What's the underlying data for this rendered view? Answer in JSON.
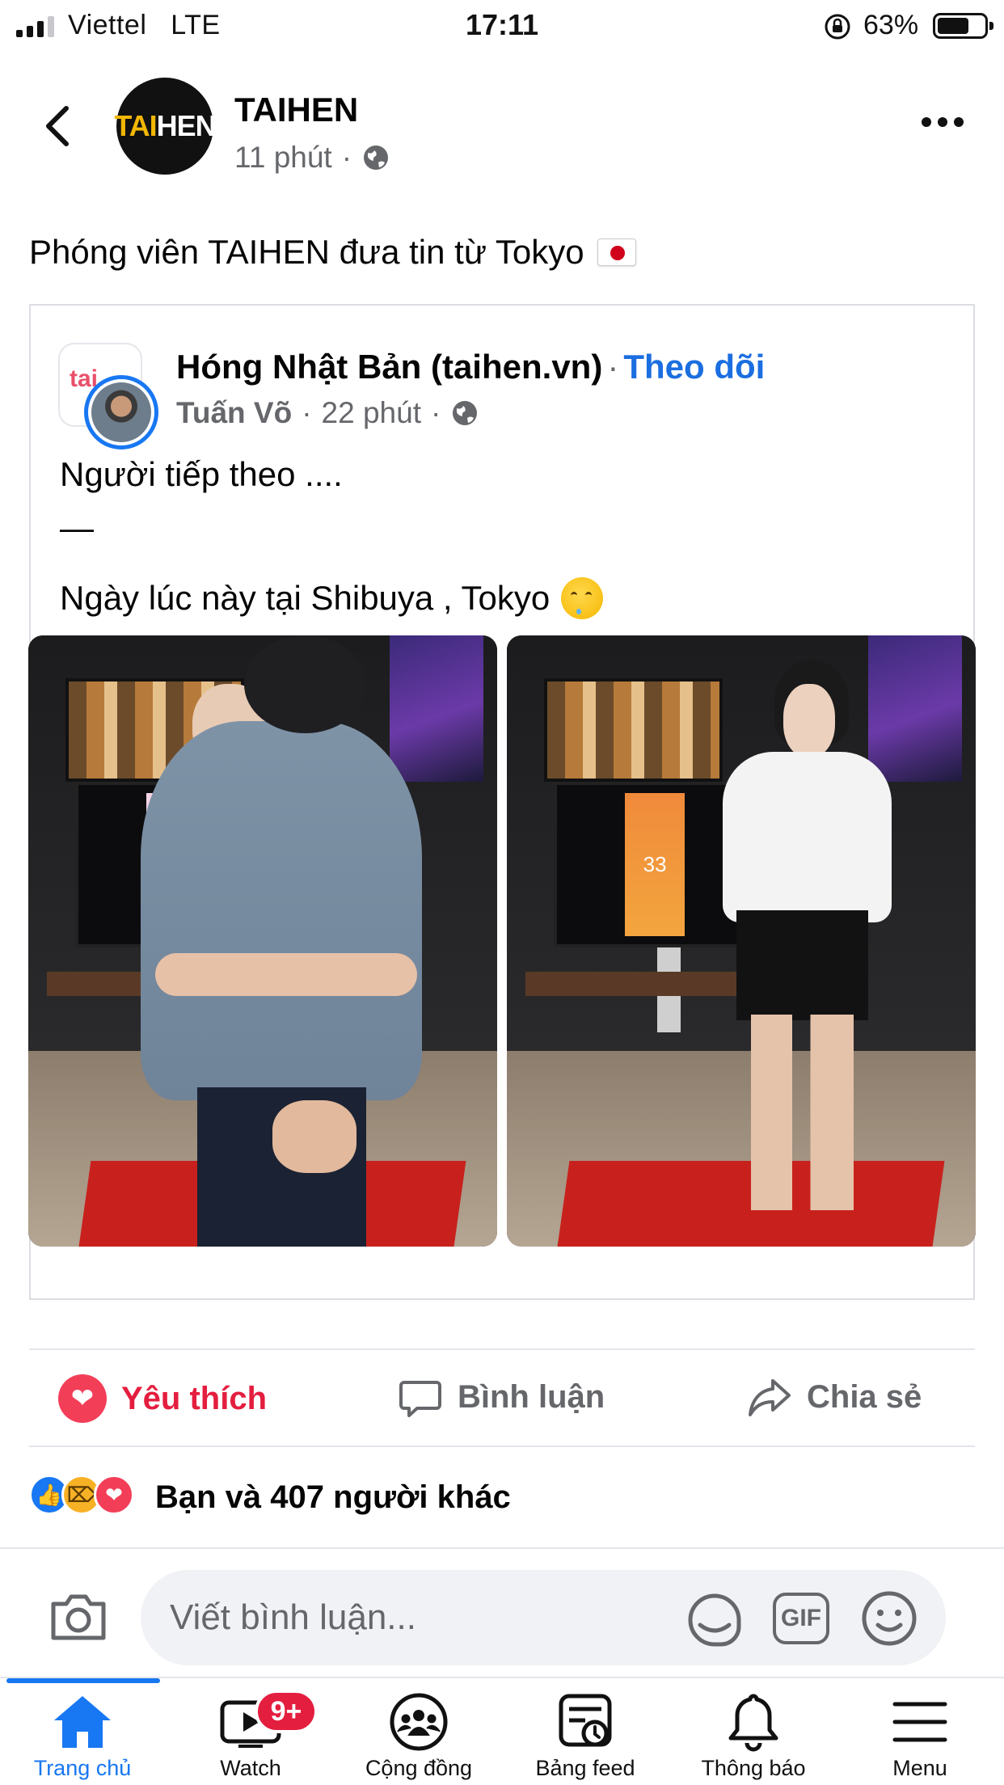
{
  "status_bar": {
    "carrier": "Viettel",
    "network": "LTE",
    "time": "17:11",
    "battery": "63%",
    "battery_level": 0.63
  },
  "post": {
    "page_name": "TAIHEN",
    "avatar_logo_a": "TAI",
    "avatar_logo_b": "HEN",
    "time": "11 phút",
    "separator": "·",
    "text": "Phóng viên TAIHEN đưa tin từ Tokyo"
  },
  "shared_post": {
    "group_name": "Hóng Nhật Bản (taihen.vn)",
    "separator": "·",
    "follow_label": "Theo dõi",
    "author": "Tuấn Võ",
    "time": "22 phút",
    "line1": "Người tiếp theo ....",
    "line2": "—",
    "line3": "Ngày lúc này tại Shibuya , Tokyo",
    "photo_right_counter": "33"
  },
  "actions": {
    "love": "Yêu thích",
    "comment": "Bình luận",
    "share": "Chia sẻ"
  },
  "reactions": {
    "summary": "Bạn và 407 người khác"
  },
  "comment_bar": {
    "placeholder": "Viết bình luận...",
    "gif_label": "GIF"
  },
  "tabs": [
    {
      "label": "Trang chủ",
      "icon": "home-icon",
      "active": true
    },
    {
      "label": "Watch",
      "icon": "watch-icon",
      "badge": "9+"
    },
    {
      "label": "Cộng đồng",
      "icon": "groups-icon"
    },
    {
      "label": "Bảng feed",
      "icon": "feed-icon"
    },
    {
      "label": "Thông báo",
      "icon": "bell-icon"
    },
    {
      "label": "Menu",
      "icon": "menu-icon"
    }
  ],
  "colors": {
    "accent": "#1877f2",
    "love": "#e41e3f",
    "follow": "#1b6ee0",
    "muted": "#65676b"
  }
}
